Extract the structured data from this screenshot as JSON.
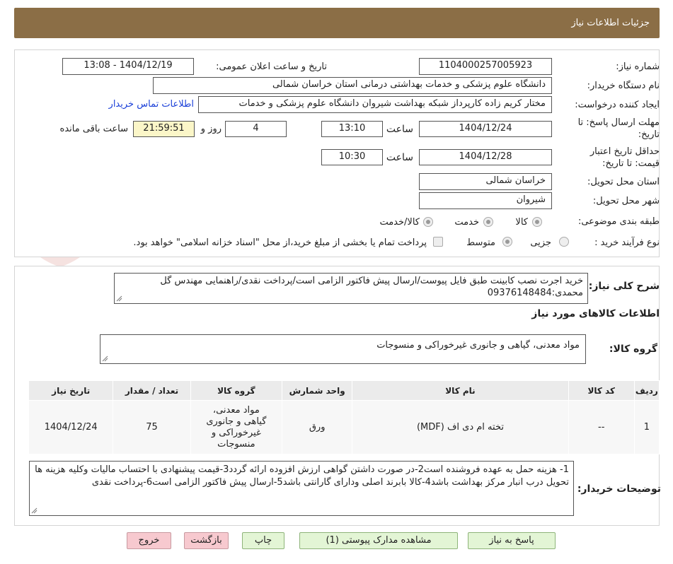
{
  "header": {
    "title": "جزئیات اطلاعات نیاز"
  },
  "watermark": "AriaTender.neT",
  "form": {
    "need_number_label": "شماره نیاز:",
    "need_number": "1104000257005923",
    "announce_label": "تاریخ و ساعت اعلان عمومی:",
    "announce_value": "1404/12/19 - 13:08",
    "buyer_org_label": "نام دستگاه خریدار:",
    "buyer_org": "دانشگاه علوم پزشکی و خدمات بهداشتی درمانی استان خراسان شمالی",
    "creator_label": "ایجاد کننده درخواست:",
    "creator": "مختار کریم زاده کارپرداز شبکه بهداشت شیروان دانشگاه علوم پزشکی و خدمات",
    "contact_link": "اطلاعات تماس خریدار",
    "reply_deadline_label_1": "مهلت ارسال پاسخ: تا",
    "reply_deadline_label_2": "تاریخ:",
    "reply_date": "1404/12/24",
    "time_label": "ساعت",
    "reply_time": "13:10",
    "days": "4",
    "days_label": "روز و",
    "remaining": "21:59:51",
    "remaining_label": "ساعت باقی مانده",
    "validity_label_1": "حداقل تاریخ اعتبار",
    "validity_label_2": "قیمت: تا تاریخ:",
    "validity_date": "1404/12/28",
    "validity_time_label": "ساعت",
    "validity_time": "10:30",
    "province_label": "استان محل تحویل:",
    "province": "خراسان شمالی",
    "city_label": "شهر محل تحویل:",
    "city": "شیروان",
    "category_label": "طبقه بندی موضوعی:",
    "category_options": [
      "کالا",
      "خدمت",
      "کالا/خدمت"
    ],
    "process_label": "نوع فرآیند خرید :",
    "process_options": [
      "جزیی",
      "متوسط"
    ],
    "process_note": "پرداخت تمام یا بخشی از مبلغ خرید،از محل \"اسناد خزانه اسلامی\" خواهد بود."
  },
  "summary": {
    "label": "شرح کلی نیاز:",
    "text": "خرید اجرت نصب کابینت طبق فایل پیوست/ارسال پیش فاکتور الزامی است/پرداخت نقدی/راهنمایی مهندس گل محمدی:09376148484",
    "goods_title": "اطلاعات کالاهای مورد نیاز",
    "group_label": "گروه کالا:",
    "group_value": "مواد معدنی، گیاهی و جانوری غیرخوراکی و منسوجات"
  },
  "table": {
    "headers": [
      "ردیف",
      "کد کالا",
      "نام کالا",
      "واحد شمارش",
      "گروه کالا",
      "تعداد / مقدار",
      "تاریخ نیاز"
    ],
    "rows": [
      [
        "1",
        "--",
        "تخته ام دی اف (MDF)",
        "ورق",
        "مواد معدنی، گیاهی و جانوری غیرخوراکی و منسوجات",
        "75",
        "1404/12/24"
      ]
    ]
  },
  "buyer_notes": {
    "label": "توضیحات خریدار:",
    "text": "1- هزینه حمل به عهده فروشنده است2-در صورت داشتن گواهی ارزش افزوده ارائه گردد3-قیمت پیشنهادی با احتساب مالیات وکلیه هزینه ها تحویل درب انبار مرکز بهداشت  باشد4-کالا بابرند اصلی ودارای گارانتی  باشد5-ارسال پیش فاکتور الزامی است6-پرداخت نقدی"
  },
  "buttons": {
    "reply": "پاسخ به نیاز",
    "attachments": "مشاهده مدارک پیوستی (1)",
    "print": "چاپ",
    "back": "بازگشت",
    "exit": "خروج"
  }
}
